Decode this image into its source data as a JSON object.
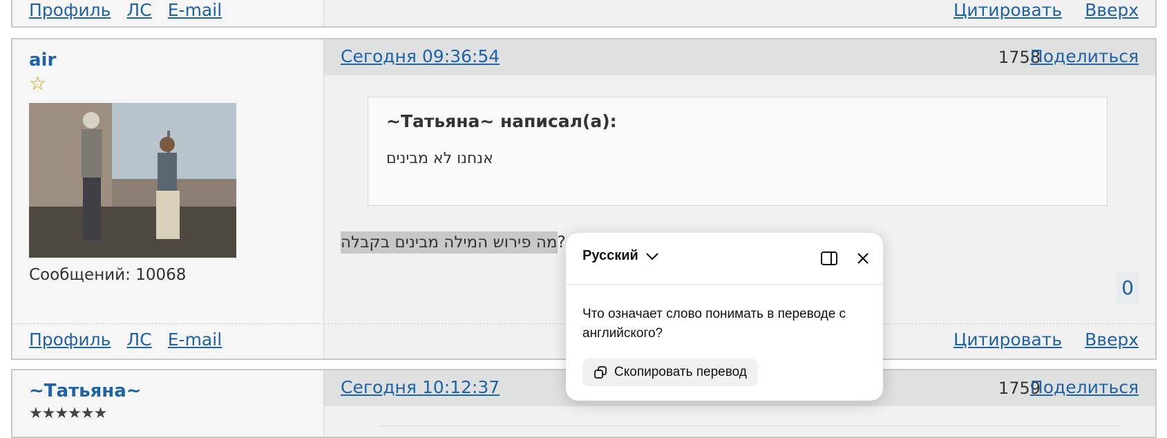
{
  "post_top": {
    "links_left": [
      "Профиль",
      "ЛС",
      "E-mail"
    ],
    "links_right": [
      "Цитировать",
      "Вверх"
    ]
  },
  "post_main": {
    "author": "air",
    "rank_stars": "☆",
    "messages_label": "Сообщений:",
    "messages_count": "10068",
    "timestamp": "Сегодня 09:36:54",
    "number": "1758",
    "share_label": "Поделиться",
    "quote_title": "~Татьяна~ написал(а):",
    "quote_text": "אנחנו לא מבינים",
    "body_text": "מה פירוש המילה מבינים בקבלה",
    "body_suffix": "?",
    "rating": "0",
    "links_left": [
      "Профиль",
      "ЛС",
      "E-mail"
    ],
    "links_right": [
      "Цитировать",
      "Вверх"
    ]
  },
  "post_next": {
    "author": "~Татьяна~",
    "rank_stars": "★★★★★★",
    "timestamp": "Сегодня 10:12:37",
    "number": "1759",
    "share_label": "Поделиться"
  },
  "translate_popup": {
    "language": "Русский",
    "translation": "Что означает слово понимать в переводе с английского?",
    "copy_label": "Скопировать перевод"
  },
  "colors": {
    "link": "#1e62a8",
    "header_bar": "#dfe0e0",
    "selection": "#c8c8c8"
  }
}
